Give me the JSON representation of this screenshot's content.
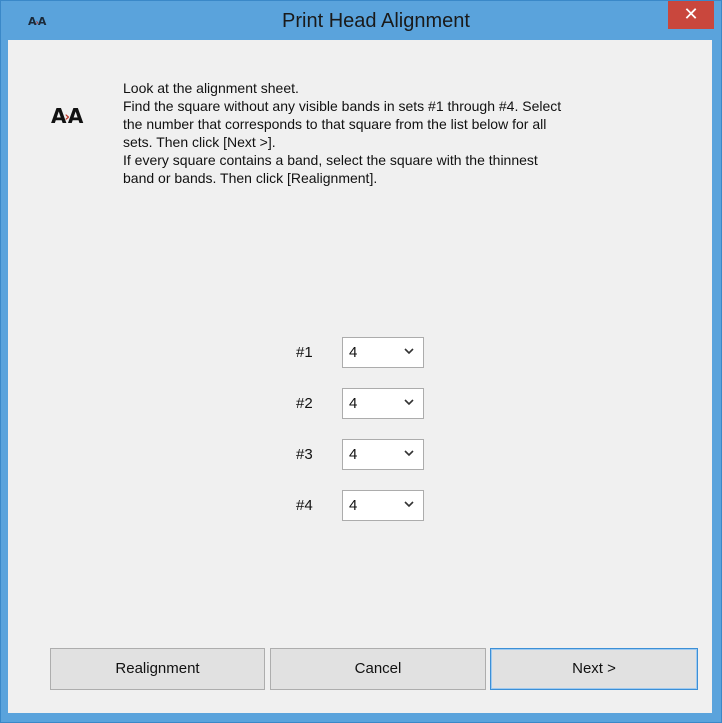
{
  "window": {
    "title": "Print Head Alignment",
    "app_icon_left": "A",
    "app_icon_arrow": "›",
    "app_icon_right": "A",
    "close_glyph": "✕"
  },
  "icon": {
    "left": "A",
    "arrow": "›",
    "right": "A"
  },
  "instructions": [
    "Look at the alignment sheet.",
    "Find the square without any visible bands in sets #1 through #4. Select",
    "the number that corresponds to that square from the list below for all",
    "sets. Then click [Next >].",
    "If every square contains a band, select the square with the thinnest",
    "band or bands. Then click [Realignment]."
  ],
  "sets": [
    {
      "label": "#1",
      "value": "4"
    },
    {
      "label": "#2",
      "value": "4"
    },
    {
      "label": "#3",
      "value": "4"
    },
    {
      "label": "#4",
      "value": "4"
    }
  ],
  "buttons": {
    "realignment": "Realignment",
    "cancel": "Cancel",
    "next": "Next >"
  },
  "colors": {
    "titlebar": "#5aa3dc",
    "close": "#c9473d",
    "client": "#f0f0f0",
    "default_button_border": "#3c8fd6"
  }
}
